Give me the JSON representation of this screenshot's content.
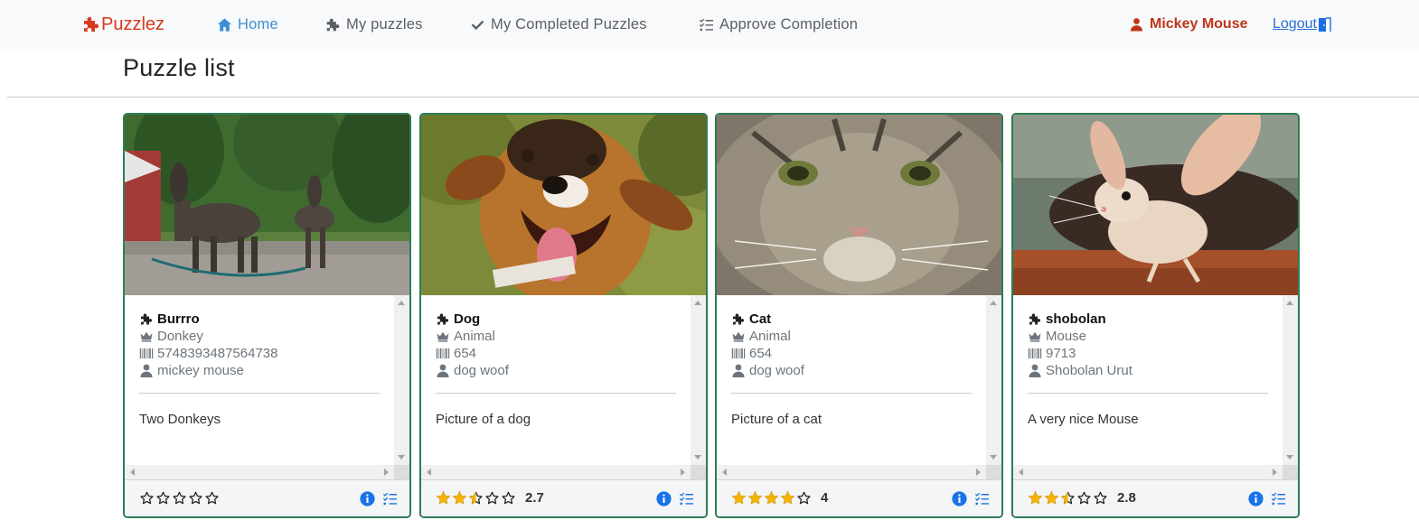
{
  "brand": {
    "name": "Puzzlez",
    "color": "#d9381e"
  },
  "nav": {
    "items": [
      {
        "label": "Home",
        "icon": "home-icon",
        "active": true
      },
      {
        "label": "My puzzles",
        "icon": "puzzle-icon"
      },
      {
        "label": "My Completed Puzzles",
        "icon": "check-icon"
      },
      {
        "label": "Approve Completion",
        "icon": "checklist-icon"
      }
    ],
    "user": "Mickey Mouse",
    "logout": "Logout"
  },
  "page": {
    "title": "Puzzle list"
  },
  "colors": {
    "accent": "#3a8fd6",
    "card_border": "#2e7d55",
    "star": "#f5b301",
    "info": "#1a73e8"
  },
  "cards": [
    {
      "name": "Burrro",
      "category": "Donkey",
      "code": "5748393487564738",
      "author": "mickey mouse",
      "description": "Two Donkeys",
      "rating": 0,
      "rating_label": "",
      "image": "two donkeys"
    },
    {
      "name": "Dog",
      "category": "Animal",
      "code": "654",
      "author": "dog woof",
      "description": "Picture of a dog",
      "rating": 2.7,
      "rating_label": "2.7",
      "image": "dog"
    },
    {
      "name": "Cat",
      "category": "Animal",
      "code": "654",
      "author": "dog woof",
      "description": "Picture of a cat",
      "rating": 4,
      "rating_label": "4",
      "image": "cat"
    },
    {
      "name": "shobolan",
      "category": "Mouse",
      "code": "9713",
      "author": "Shobolan Urut",
      "description": "A very nice Mouse",
      "rating": 2.8,
      "rating_label": "2.8",
      "image": "jerboa"
    }
  ]
}
